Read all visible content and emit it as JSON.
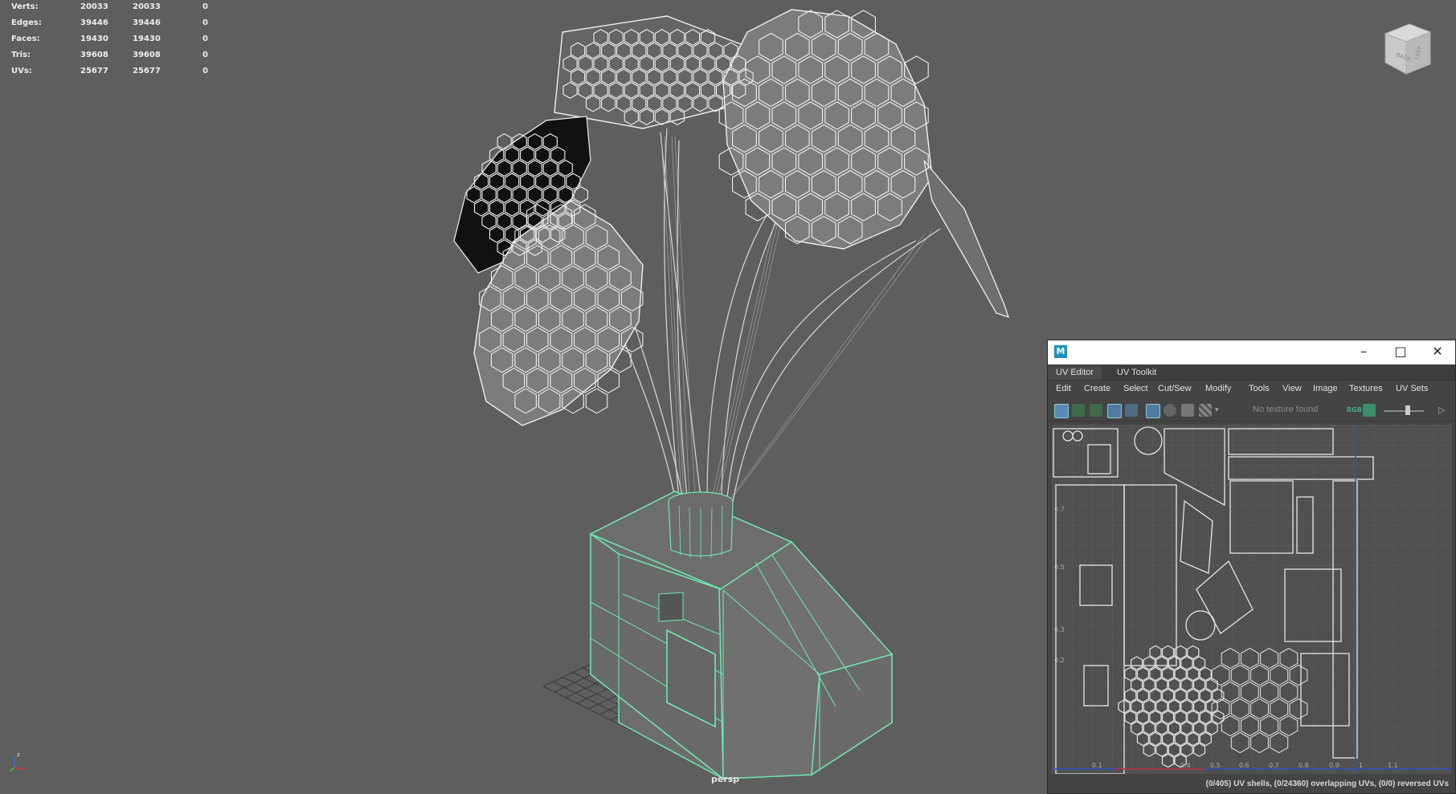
{
  "hud": {
    "rows": [
      {
        "label": "Verts:",
        "v1": "20033",
        "v2": "20033",
        "v3": "0"
      },
      {
        "label": "Edges:",
        "v1": "39446",
        "v2": "39446",
        "v3": "0"
      },
      {
        "label": "Faces:",
        "v1": "19430",
        "v2": "19430",
        "v3": "0"
      },
      {
        "label": "Tris:",
        "v1": "39608",
        "v2": "39608",
        "v3": "0"
      },
      {
        "label": "UVs:",
        "v1": "25677",
        "v2": "25677",
        "v3": "0"
      }
    ]
  },
  "viewport": {
    "camera_label": "persp",
    "view_cube": {
      "face_back": "BACK",
      "face_left": "LEFT"
    }
  },
  "uv_window": {
    "app_icon": "M",
    "tabs": [
      {
        "label": "UV Editor"
      },
      {
        "label": "UV Toolkit"
      }
    ],
    "menus": [
      "Edit",
      "Create",
      "Select",
      "Cut/Sew",
      "Modify",
      "Tools",
      "View",
      "Image",
      "Textures",
      "UV Sets"
    ],
    "texture_status": "No texture found",
    "rgb_label": "RGB",
    "status_bar": "(0/405) UV shells, (0/24360) overlapping UVs, (0/0) reversed UVs",
    "grid_labels": {
      "v": [
        "0.7",
        "0.5",
        "0.3",
        "0.2"
      ],
      "u": [
        "0.1",
        "0.4",
        "0.5",
        "0.6",
        "0.7",
        "0.8",
        "0.9",
        "1",
        "1.1"
      ]
    }
  },
  "colors": {
    "viewport_bg": "#5e5e5e",
    "wire_white": "#e8e8e8",
    "wire_selected": "#6ee8b0"
  }
}
